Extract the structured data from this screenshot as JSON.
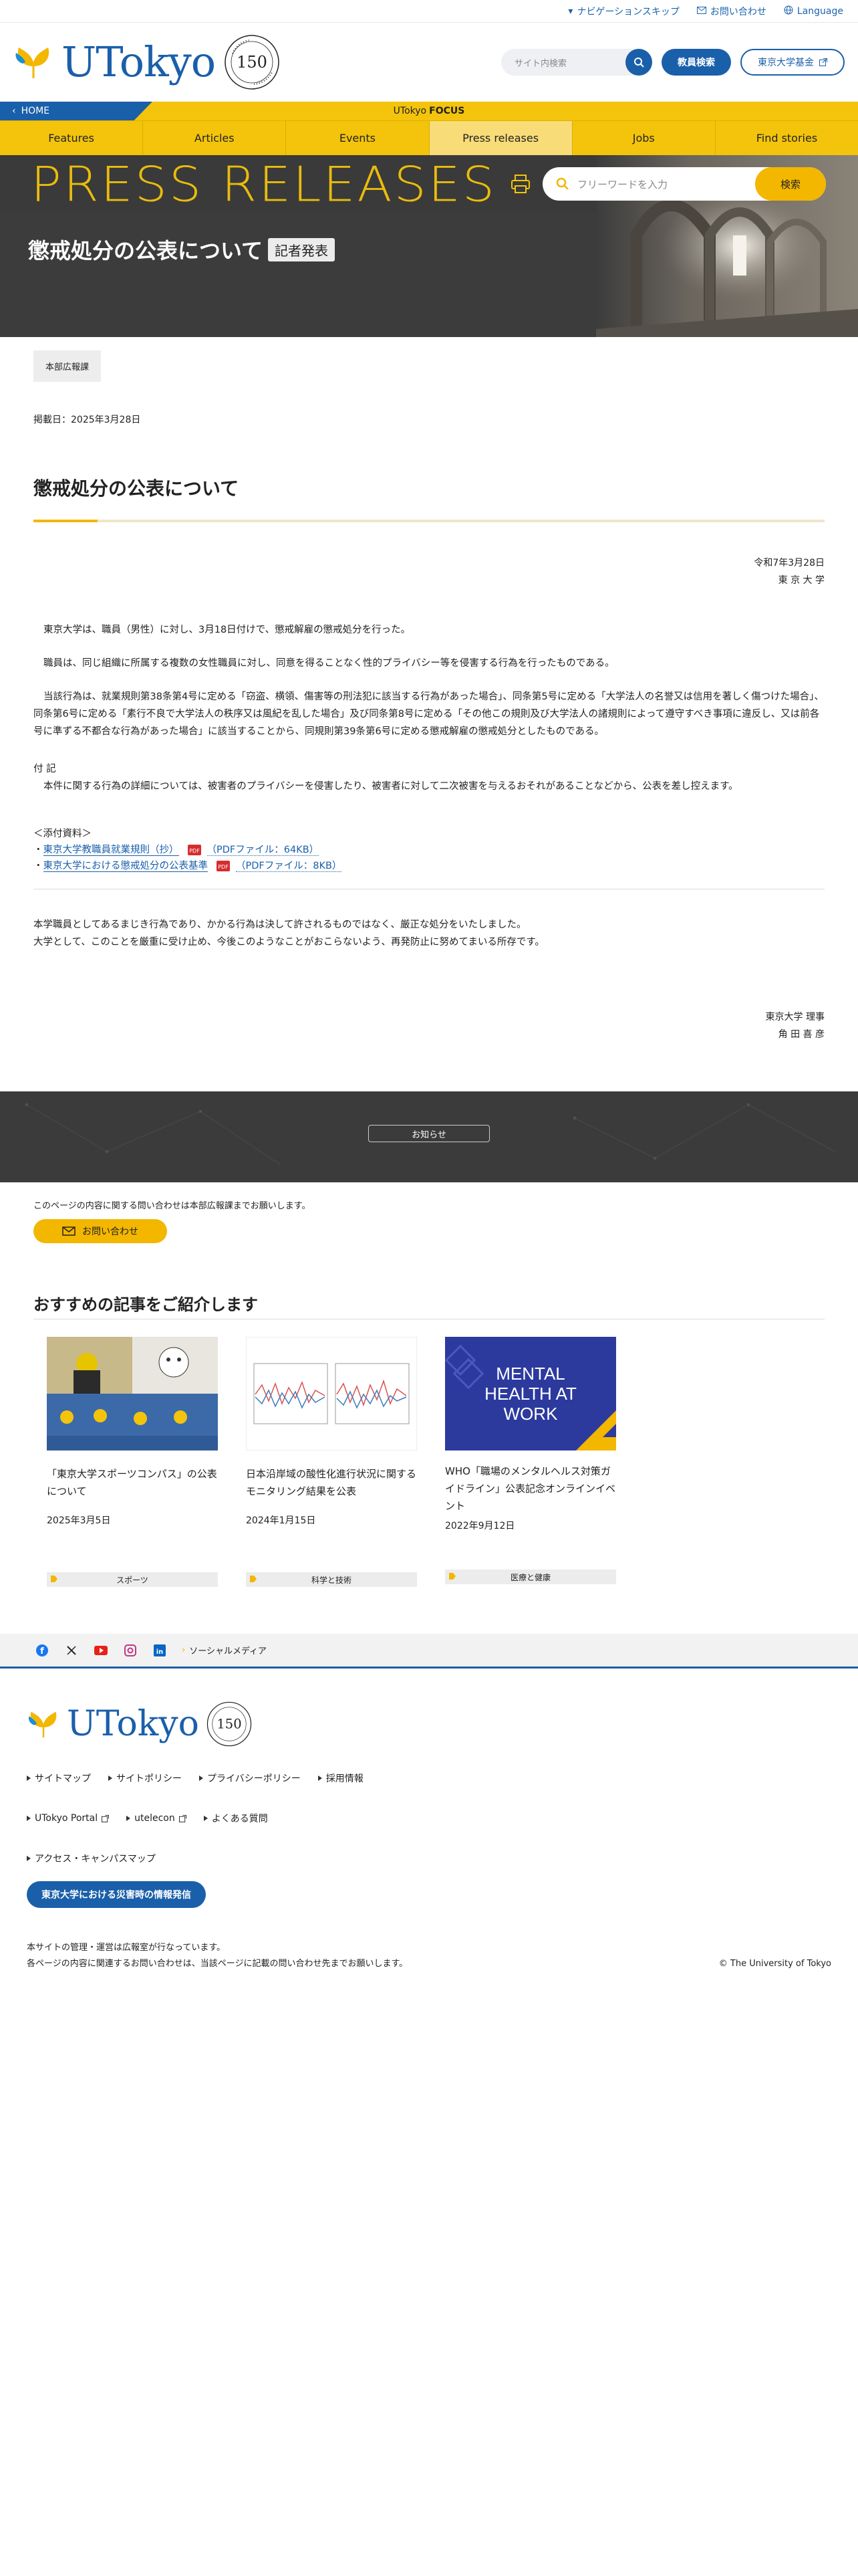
{
  "util": {
    "skip_nav": "ナビゲーションスキップ",
    "contact": "お問い合わせ",
    "language": "Language"
  },
  "header": {
    "logo_text": "UTokyo",
    "anniv": "150",
    "search_placeholder": "サイト内検索",
    "faculty_btn": "教員検索",
    "fund_btn": "東京大学基金"
  },
  "focus": {
    "home": "HOME",
    "utokyo": "UTokyo",
    "focus": "FOCUS"
  },
  "nav": [
    "Features",
    "Articles",
    "Events",
    "Press releases",
    "Jobs",
    "Find stories"
  ],
  "hero": {
    "section": "PRESS RELEASES",
    "search_placeholder": "フリーワードを入力",
    "search_btn": "検索",
    "title": "懲戒処分の公表について",
    "tag": "記者発表"
  },
  "article": {
    "dept": "本部広報課",
    "posted": "掲載日：2025年3月28日",
    "heading": "懲戒処分の公表について",
    "date": "令和7年3月28日",
    "org": "東 京 大 学",
    "p1": "東京大学は、職員（男性）に対し、3月18日付けで、懲戒解雇の懲戒処分を行った。",
    "p2": "職員は、同じ組織に所属する複数の女性職員に対し、同意を得ることなく性的プライバシー等を侵害する行為を行ったものである。",
    "p3": "当該行為は、就業規則第38条第4号に定める「窃盗、横領、傷害等の刑法犯に該当する行為があった場合」、同条第5号に定める「大学法人の名誉又は信用を著しく傷つけた場合」、同条第6号に定める「素行不良で大学法人の秩序又は風紀を乱した場合」及び同条第8号に定める「その他この規則及び大学法人の諸規則によって遵守すべき事項に違反し、又は前各号に準ずる不都合な行為があった場合」に該当することから、同規則第39条第6号に定める懲戒解雇の懲戒処分としたものである。",
    "note_label": "付 記",
    "note": "本件に関する行為の詳細については、被害者のプライバシーを侵害したり、被害者に対して二次被害を与えるおそれがあることなどから、公表を差し控えます。",
    "attach_label": "＜添付資料＞",
    "attach": [
      {
        "prefix": "・",
        "text": "東京大学教職員就業規則（抄）",
        "meta": "（PDFファイル：64KB）"
      },
      {
        "prefix": "・",
        "text": "東京大学における懲戒処分の公表基準",
        "meta": "（PDFファイル：8KB）"
      }
    ],
    "closing1": "本学職員としてあるまじき行為であり、かかる行為は決して許されるものではなく、厳正な処分をいたしました。",
    "closing2": "大学として、このことを厳重に受け止め、今後このようなことがおこらないよう、再発防止に努めてまいる所存です。",
    "sign1": "東京大学 理事",
    "sign2": "角 田 喜 彦"
  },
  "notice": {
    "btn": "お知らせ"
  },
  "contact": {
    "text": "このページの内容に関する問い合わせは本部広報課までお願いします。",
    "btn": "お問い合わせ"
  },
  "recommended": {
    "heading": "おすすめの記事をご紹介します",
    "cards": [
      {
        "title": "「東京大学スポーツコンパス」の公表について",
        "date": "2025年3月5日",
        "tag": "スポーツ"
      },
      {
        "title": "日本沿岸域の酸性化進行状況に関するモニタリング結果を公表",
        "date": "2024年1月15日",
        "tag": "科学と技術"
      },
      {
        "title": "WHO「職場のメンタルヘルス対策ガイドライン」公表記念オンラインイベント",
        "date": "2022年9月12日",
        "tag": "医療と健康",
        "thumb_text": "MENTAL HEALTH AT WORK"
      }
    ]
  },
  "social": {
    "label": "ソーシャルメディア"
  },
  "footer": {
    "logo_text": "UTokyo",
    "links_row1": [
      "サイトマップ",
      "サイトポリシー",
      "プライバシーポリシー",
      "採用情報"
    ],
    "links_row2": [
      "UTokyo Portal",
      "utelecon",
      "よくある質問"
    ],
    "links_row3": [
      "アクセス・キャンパスマップ"
    ],
    "disaster": "東京大学における災害時の情報発信",
    "note1": "本サイトの管理・運営は広報室が行なっています。",
    "note2": "各ページの内容に関連するお問い合わせは、当該ページに記載の問い合わせ先までお願いします。",
    "copyright": "© The University of Tokyo"
  },
  "colors": {
    "brand_blue": "#1a5faa",
    "brand_yellow": "#f3c40b",
    "hero_dark": "#3c3c3c"
  }
}
